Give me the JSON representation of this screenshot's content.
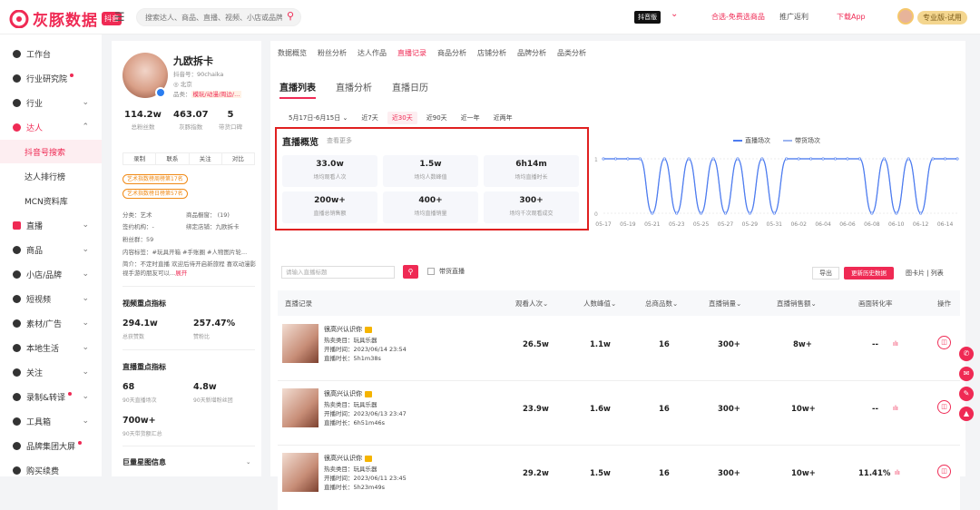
{
  "topbar": {
    "logo": "灰豚数据",
    "logo_badge": "抖音",
    "search_placeholder": "搜索达人、商品、直播、视频、小店或品牌",
    "platform": "抖音版",
    "links": [
      "合选-免费选商品",
      "推广返利",
      "下载App"
    ],
    "plan": "专业版-试用"
  },
  "sidebar": {
    "items": [
      {
        "label": "工作台",
        "chev": ""
      },
      {
        "label": "行业研究院",
        "chev": "",
        "dot": true
      },
      {
        "label": "行业",
        "chev": "⌄"
      },
      {
        "label": "达人",
        "chev": "⌃"
      },
      {
        "label": "抖音号搜索",
        "chev": "",
        "sub": true
      },
      {
        "label": "达人排行榜",
        "chev": "",
        "sub": true
      },
      {
        "label": "MCN资料库",
        "chev": "",
        "sub": true
      },
      {
        "label": "直播",
        "chev": "⌄"
      },
      {
        "label": "商品",
        "chev": "⌄"
      },
      {
        "label": "小店/品牌",
        "chev": "⌄"
      },
      {
        "label": "短视频",
        "chev": "⌄"
      },
      {
        "label": "素材/广告",
        "chev": "⌄"
      },
      {
        "label": "本地生活",
        "chev": "⌄"
      },
      {
        "label": "关注",
        "chev": "⌄"
      },
      {
        "label": "录制&转译",
        "chev": "⌄",
        "dot": true
      },
      {
        "label": "工具箱",
        "chev": "⌄"
      },
      {
        "label": "品牌集团大屏",
        "chev": "",
        "dot": true
      },
      {
        "label": "购买续费",
        "chev": ""
      }
    ]
  },
  "profile": {
    "name": "九欧拆卡",
    "id": "抖音号：90chaika",
    "location": "北京",
    "category_label": "品类：",
    "category": "模玩/动漫/周边/...",
    "stats": [
      {
        "value": "114.2w",
        "label": "总粉丝数"
      },
      {
        "value": "463.07",
        "label": "灰豚指数"
      },
      {
        "value": "5",
        "label": "带货口碑"
      }
    ],
    "actions": [
      "录制",
      "联系",
      "关注",
      "对比"
    ],
    "rank_tags": [
      "艺术指数榜周榜第17名",
      "艺术指数榜日榜第57名"
    ],
    "category_field": "分类：艺术",
    "window": "商品橱窗： (19)",
    "org": "签约机构：-",
    "shop": "绑定店铺：九欧拆卡",
    "fan_group": "粉丝群：59",
    "content_tags": "内容标签：#玩具开箱 #手账圈 #人物图片轮...",
    "intro": "简介：不定时直播 欢迎后待开启新旅程 喜欢动漫影视手游的朋友可以...",
    "intro_more": "展开",
    "video_section": "视频重点指标",
    "video_metrics": [
      {
        "value": "294.1w",
        "label": "总获赞数"
      },
      {
        "value": "257.47%",
        "label": "赞粉比"
      }
    ],
    "live_section": "直播重点指标",
    "live_metrics": [
      {
        "value": "68",
        "label": "90天直播场次"
      },
      {
        "value": "4.8w",
        "label": "90天新增粉丝团"
      }
    ],
    "live_metric3_value": "700w+",
    "live_metric3_label": "90天带货额汇总",
    "star_section": "巨量星图信息"
  },
  "main": {
    "tabs": [
      "数据概览",
      "粉丝分析",
      "达人作品",
      "直播记录",
      "商品分析",
      "店铺分析",
      "品牌分析",
      "品类分析"
    ],
    "subtabs": [
      "直播列表",
      "直播分析",
      "直播日历"
    ],
    "filters": [
      "5月17日-6月15日 ⌄",
      "近7天",
      "近30天",
      "近90天",
      "近一年",
      "近两年"
    ],
    "overview_title": "直播概览",
    "overview_more": "查看更多",
    "overview_cards": [
      {
        "value": "33.0w",
        "label": "场均观看人次"
      },
      {
        "value": "1.5w",
        "label": "场均人数峰值"
      },
      {
        "value": "6h14m",
        "label": "场均直播时长"
      },
      {
        "value": "200w+",
        "label": "直播总销售额"
      },
      {
        "value": "400+",
        "label": "场均直播销量"
      },
      {
        "value": "300+",
        "label": "场均千次观看成交"
      }
    ],
    "legend": [
      "直播场次",
      "带货场次"
    ],
    "list_search_placeholder": "请输入直播标题",
    "checkbox_label": "带货直播",
    "export": "导出",
    "update": "更新历史数据",
    "view_toggle": "图卡片  |  列表",
    "columns": [
      "直播记录",
      "观看人次⌄",
      "人数峰值⌄",
      "总商品数⌄",
      "直播销量⌄",
      "直播销售额⌄",
      "画面转化率",
      "操作"
    ],
    "rows": [
      {
        "title": "很高兴认识你",
        "cat": "热卖类目：玩具乐器",
        "start": "开播时间：2023/06/14 23:54",
        "dur": "直播时长：5h1m38s",
        "views": "26.5w",
        "peak": "1.1w",
        "goods": "16",
        "sales": "300+",
        "gmv": "8w+",
        "conv": "--"
      },
      {
        "title": "很高兴认识你",
        "cat": "热卖类目：玩具乐器",
        "start": "开播时间：2023/06/13 23:47",
        "dur": "直播时长：6h51m46s",
        "views": "23.9w",
        "peak": "1.6w",
        "goods": "16",
        "sales": "300+",
        "gmv": "10w+",
        "conv": "--"
      },
      {
        "title": "很高兴认识你",
        "cat": "热卖类目：玩具乐器",
        "start": "开播时间：2023/06/11 23:45",
        "dur": "直播时长：5h23m49s",
        "views": "29.2w",
        "peak": "1.5w",
        "goods": "16",
        "sales": "300+",
        "gmv": "10w+",
        "conv": "11.41%"
      }
    ]
  },
  "chart_data": {
    "type": "line",
    "x": [
      "05-17",
      "05-18",
      "05-19",
      "05-20",
      "05-21",
      "05-22",
      "05-23",
      "05-24",
      "05-25",
      "05-26",
      "05-27",
      "05-28",
      "05-29",
      "05-30",
      "05-31",
      "06-01",
      "06-02",
      "06-03",
      "06-04",
      "06-05",
      "06-06",
      "06-07",
      "06-08",
      "06-09",
      "06-10",
      "06-11",
      "06-12",
      "06-13",
      "06-14",
      "06-15"
    ],
    "x_ticks": [
      "05-17",
      "05-19",
      "05-21",
      "05-23",
      "05-25",
      "05-27",
      "05-29",
      "05-31",
      "06-02",
      "06-04",
      "06-06",
      "06-08",
      "06-10",
      "06-12",
      "06-14"
    ],
    "series": [
      {
        "name": "直播场次",
        "color": "#4d7cf0",
        "values": [
          1,
          1,
          1,
          1,
          0,
          1,
          0,
          1,
          0,
          1,
          0,
          1,
          0,
          1,
          0,
          1,
          1,
          1,
          1,
          1,
          1,
          1,
          0,
          1,
          0,
          1,
          0,
          1,
          1,
          1
        ]
      },
      {
        "name": "带货场次",
        "color": "#9cb4f0",
        "values": [
          1,
          1,
          1,
          1,
          0,
          1,
          0,
          1,
          0,
          1,
          0,
          1,
          0,
          1,
          0,
          1,
          1,
          1,
          1,
          1,
          1,
          1,
          0,
          1,
          0,
          1,
          0,
          1,
          1,
          1
        ]
      }
    ],
    "ylim": [
      0,
      1
    ],
    "y_ticks": [
      "0",
      "1"
    ]
  }
}
